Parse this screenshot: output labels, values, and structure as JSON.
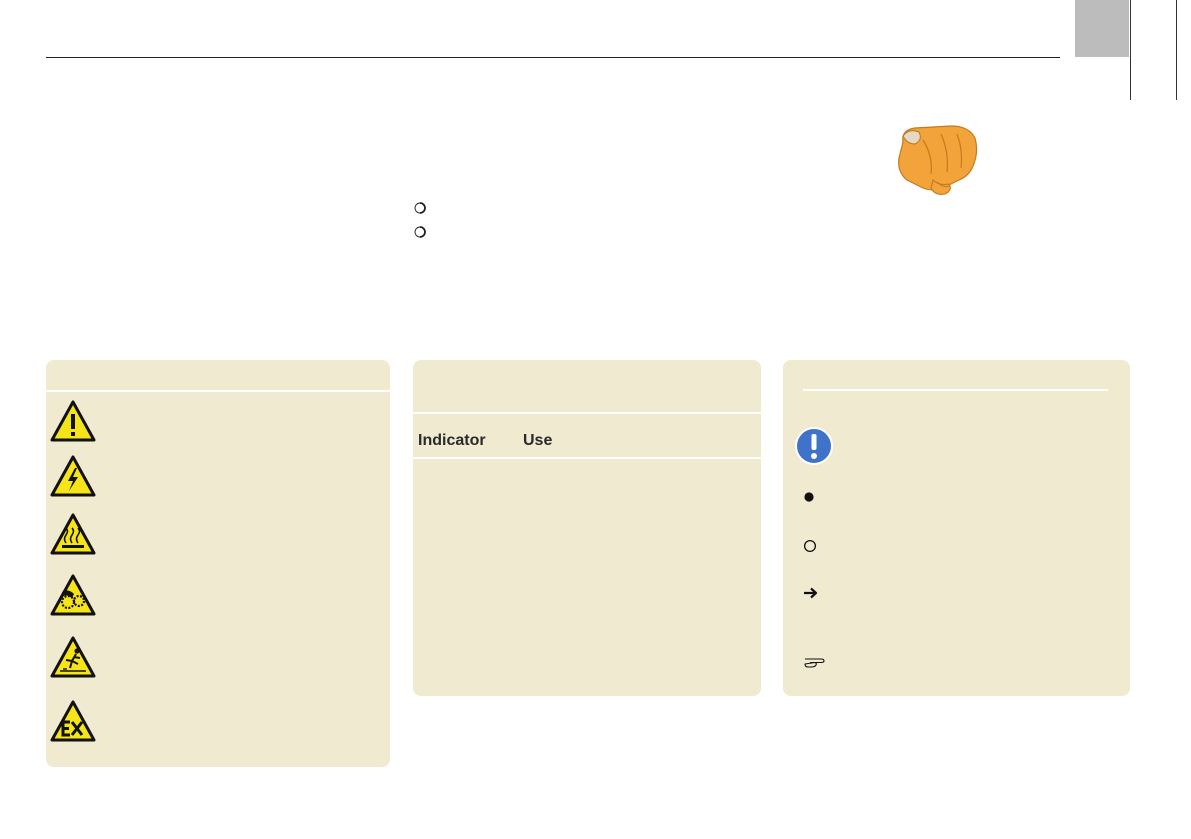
{
  "table": {
    "header_indicator": "Indicator",
    "header_use": "Use"
  },
  "colors": {
    "panel_bg": "#efead0",
    "header_tab": "#bcbcbc",
    "warning_yellow": "#f5e417",
    "info_blue": "#3f73c9",
    "hand_orange": "#f2a43b"
  },
  "icons": {
    "list_bullets": [
      "ring-bullet-icon",
      "ring-bullet-icon"
    ],
    "hazard_signs": [
      "general-warning-icon",
      "electrical-hazard-icon",
      "hot-surface-icon",
      "entanglement-hazard-icon",
      "slip-hazard-icon",
      "explosive-atmosphere-icon"
    ],
    "legend_symbols": [
      "important-info-icon",
      "filled-bullet-icon",
      "open-bullet-icon",
      "arrow-right-icon",
      "pointing-hand-small-icon"
    ]
  }
}
